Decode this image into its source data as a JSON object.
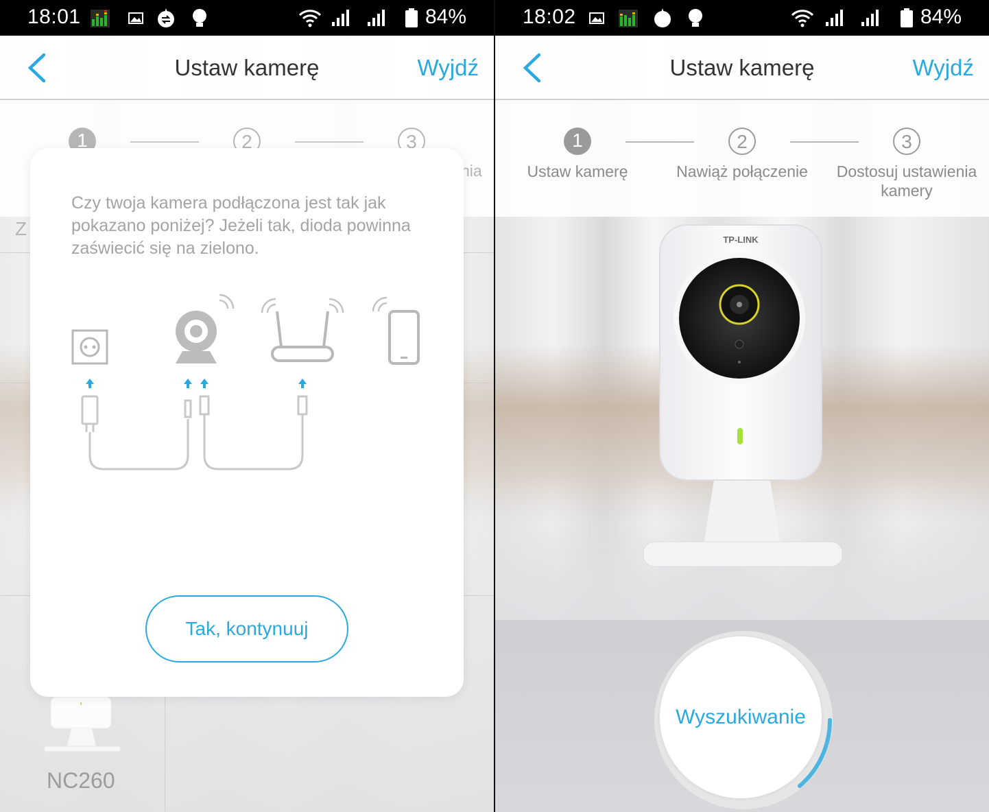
{
  "left_screen": {
    "status_bar": {
      "time": "18:01",
      "battery_percent": "84%",
      "icons": [
        "equalizer-icon",
        "gallery-icon",
        "sync-icon",
        "bulb-icon",
        "wifi-icon",
        "signal-icon",
        "signal-icon",
        "battery-icon"
      ]
    },
    "header": {
      "title": "Ustaw kamerę",
      "exit_label": "Wyjdź",
      "back_icon": "chevron-left-icon"
    },
    "stepper": {
      "steps": [
        {
          "number": "1",
          "active": true
        },
        {
          "number": "2",
          "active": false
        },
        {
          "number": "3",
          "active": false
        }
      ],
      "partial_step3_text": "nia",
      "partial_left_text": "Z"
    },
    "dialog": {
      "message": "Czy twoja kamera podłączona jest tak jak pokazano poniżej? Jeżeli tak, dioda powinna zaświecić się na zielono.",
      "confirm_label": "Tak, kontynuuj",
      "diagram_icons": [
        "power-outlet-icon",
        "webcam-icon",
        "router-icon",
        "smartphone-icon",
        "power-adapter-icon",
        "ethernet-plug-icon"
      ]
    },
    "product_label": "NC260"
  },
  "right_screen": {
    "status_bar": {
      "time": "18:02",
      "battery_percent": "84%",
      "icons": [
        "gallery-icon",
        "equalizer-icon",
        "bomb-icon",
        "bulb-icon",
        "wifi-icon",
        "signal-icon",
        "signal-icon",
        "battery-icon"
      ]
    },
    "header": {
      "title": "Ustaw kamerę",
      "exit_label": "Wyjdź",
      "back_icon": "chevron-left-icon"
    },
    "stepper": {
      "steps": [
        {
          "number": "1",
          "label": "Ustaw kamerę",
          "active": true
        },
        {
          "number": "2",
          "label": "Nawiąż połączenie",
          "active": false
        },
        {
          "number": "3",
          "label": "Dostosuj ustawienia kamery",
          "active": false
        }
      ]
    },
    "camera": {
      "brand": "TP-LINK",
      "led_color": "#a6e13a"
    },
    "search_button": {
      "label": "Wyszukiwanie"
    }
  },
  "colors": {
    "accent": "#28a9e0",
    "status_bar": "#000000",
    "step_active": "#9a9a9a"
  }
}
